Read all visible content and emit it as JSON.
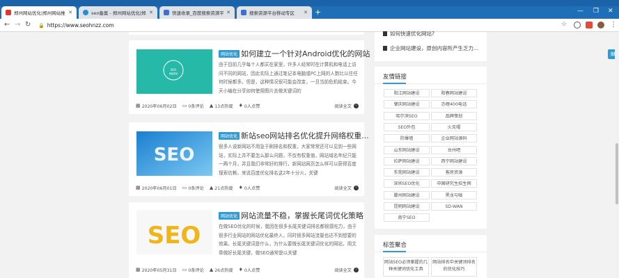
{
  "browser": {
    "tabs": [
      {
        "title": "郑州网站优化|郑州网站推广|郑..."
      },
      {
        "title": "seo备案 - 郑州网站优化|郑州网..."
      },
      {
        "title": "快速收录_百度搜索资源平台"
      },
      {
        "title": "搜索资源平台移动专区"
      }
    ],
    "url": "https://www.seohnzz.com",
    "new_tab": "+",
    "win_min": "—",
    "win_max": "❐",
    "win_close": "✕"
  },
  "articles": [
    {
      "tag": "网站优化",
      "title": "如何建立一个针对Android优化的网站",
      "excerpt": "由于目前几乎每个人都买在家里，许多人经常时在计算机和电话上访问不同的网站，因此实际上通过笔记本电脑或PC上网的人数比以往任何时候都多。但是，这种情况很可能会改变，一旦当前危机结束。今天小编在分享如何使用图片去做关键词的",
      "date": "2020年06月02日",
      "comments": "0条评论",
      "views": "13点热度",
      "likes": "0人点赞",
      "more": "阅读全文"
    },
    {
      "tag": "网站优化",
      "title": "新站seo网站排名优化提升网络权重...",
      "excerpt": "很多人说新网站不用急于刷排名和权重，大家常常还可以见到一些网站，实际上并不要怎么那么问题，不仅有权重值，网站域名年纪只能一两个月，并且我们非常好的排行，新网站网页怎么样可以获得百度搜索信赖，来说百度优化排名这2年十分火，关键",
      "date": "2020年06月01日",
      "comments": "0条评论",
      "views": "21点热度",
      "likes": "0人点赞",
      "more": "阅读全文"
    },
    {
      "tag": "网站优化",
      "title": "网站流量不稳，掌握长尾词优化策略",
      "excerpt": "在做SEO优化的时候，我因在很多长尾关键词排名都很感吃力，由于很多行业网站的网站优化最终人，同时很多网站流量也达不到想要的效果。长尾关键词是什么，为什么要做长尾关键词优化的网站，用文章做好长尾关键，做SEO通常是以关键",
      "date": "2020年05月31日",
      "comments": "0条评论",
      "views": "26点热度",
      "likes": "0人点赞",
      "more": "阅读全文"
    }
  ],
  "hot_posts": [
    {
      "text": "如何快速优化网站?"
    },
    {
      "text": "企业网站建设，原创内容所产生乏力..."
    }
  ],
  "friend_links": {
    "heading": "友情链接",
    "items": [
      "阳江网站建设",
      "阳春网站建设",
      "肇庆网站建设",
      "办理400电话",
      "哈尔滨SEO",
      "品牌策划",
      "SEO外包",
      "火克帽",
      "防爆墙",
      "企业网站源码",
      "山东网站建设",
      "台州吧",
      "拉萨网站建设",
      "西宁网站建设",
      "东莞网站建设",
      "客房资源",
      "深圳SEO优化",
      "中国研究生招生网",
      "滕州网站建设",
      "黑龙与咖",
      "昆明网站建设",
      "SD-WAN",
      "南宁SEO"
    ]
  },
  "tags": {
    "heading": "标签聚合",
    "items": [
      "网站SEO必须掌握的几种关键词优化工具",
      "网站排名中关键词排名的优化技巧"
    ]
  },
  "colors": {
    "accent": "#2f9bd6",
    "tabbar": "#1e6fb8"
  }
}
